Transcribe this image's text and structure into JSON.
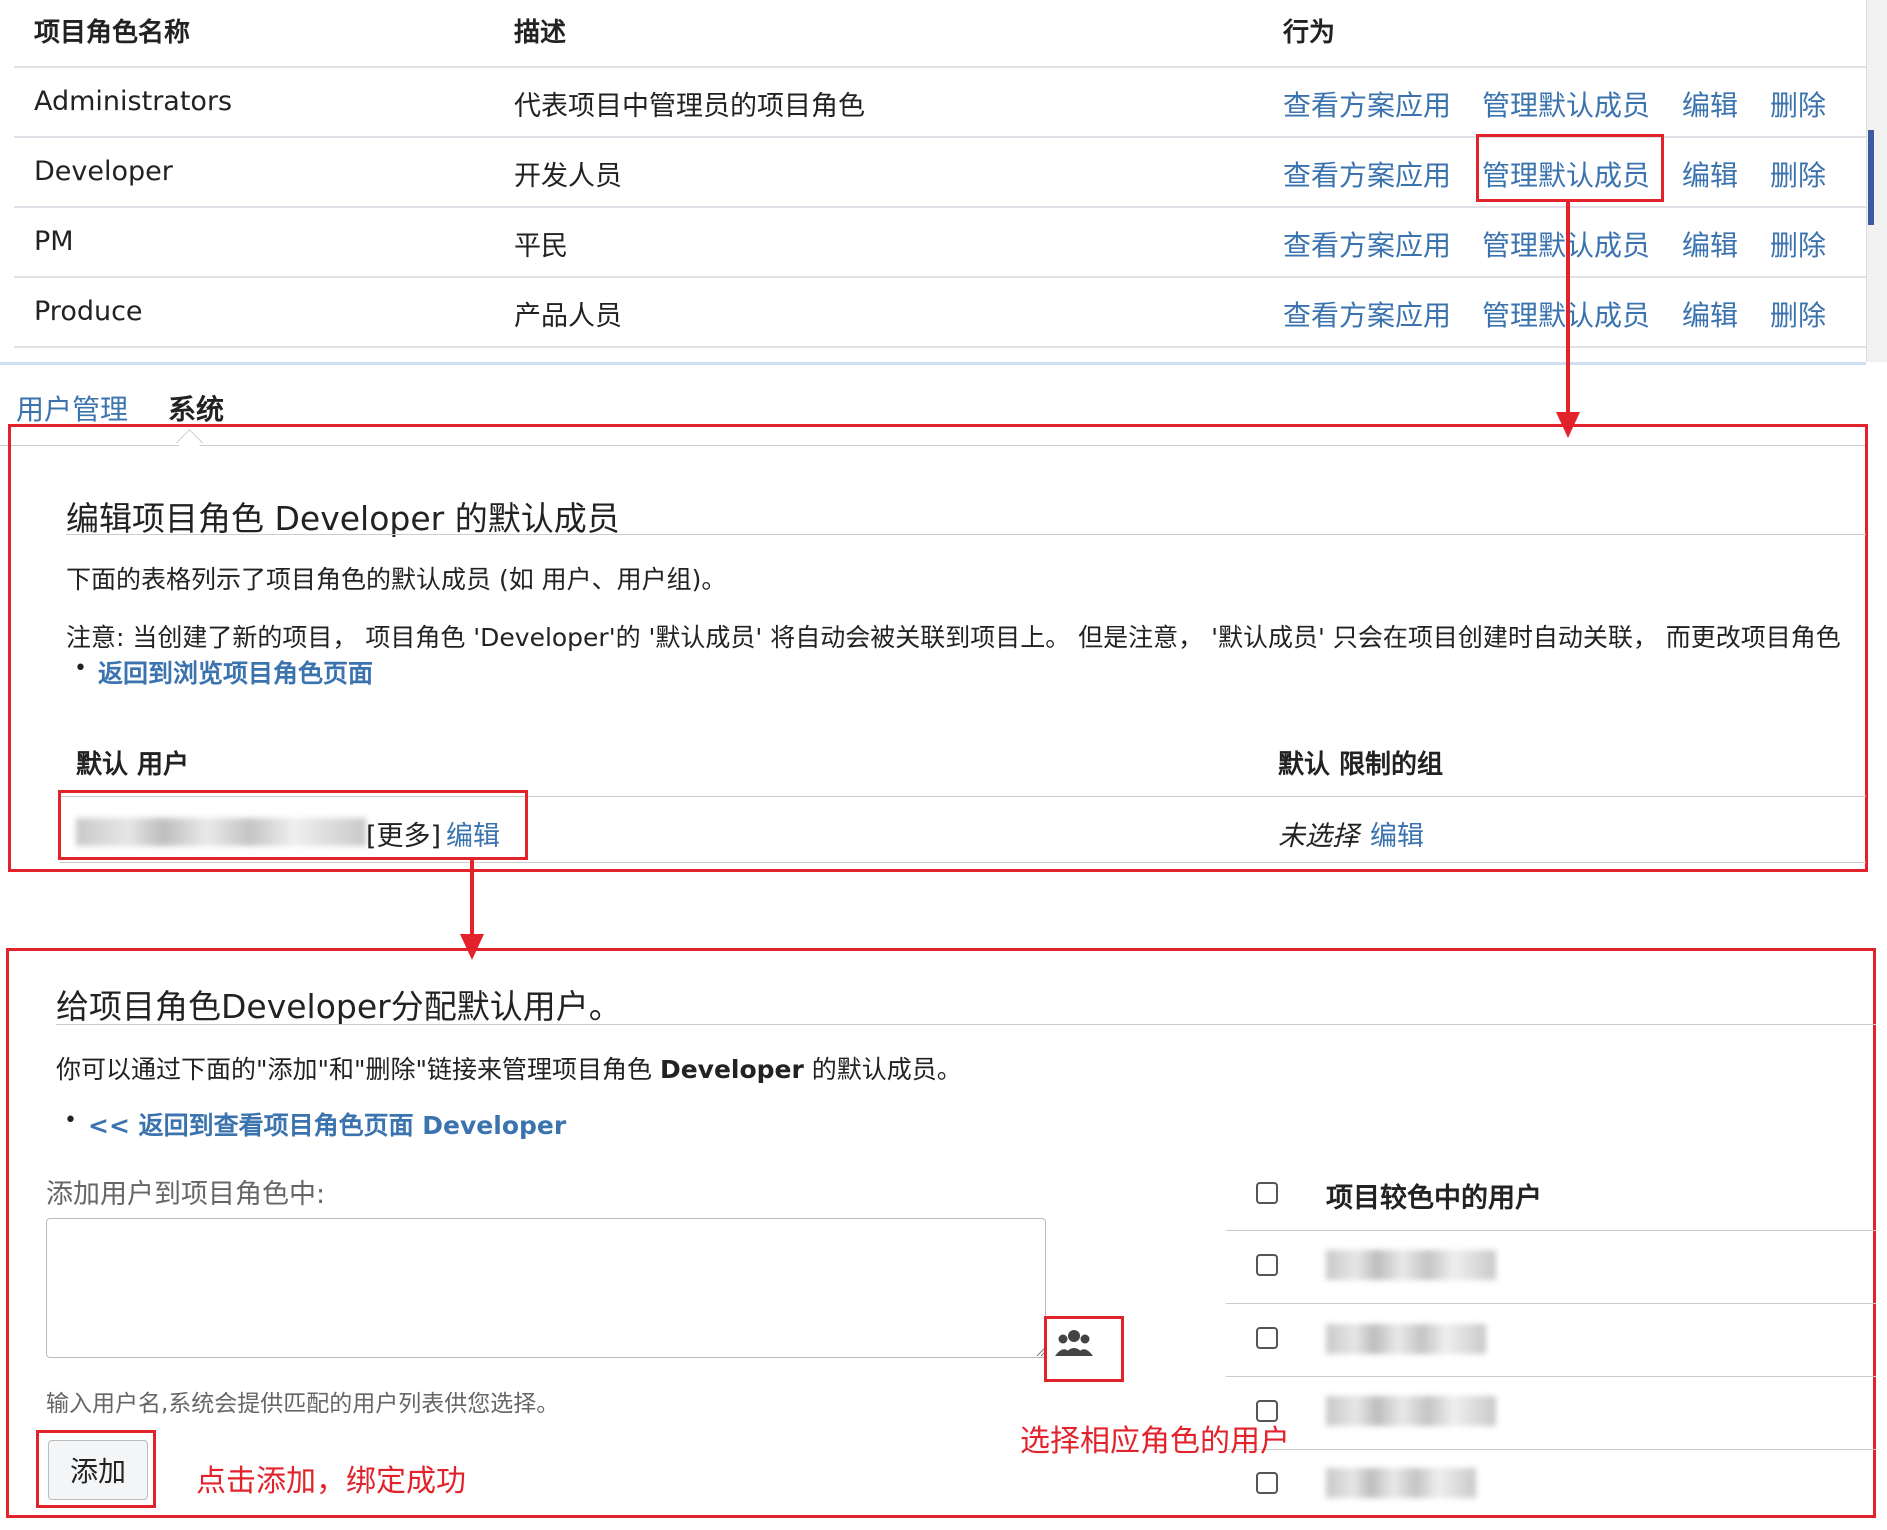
{
  "roles_table": {
    "headers": {
      "name": "项目角色名称",
      "description": "描述",
      "actions": "行为"
    },
    "rows": [
      {
        "name": "Administrators",
        "description": "代表项目中管理员的项目角色"
      },
      {
        "name": "Developer",
        "description": "开发人员"
      },
      {
        "name": "PM",
        "description": "平民"
      },
      {
        "name": "Produce",
        "description": "产品人员"
      }
    ],
    "actions": {
      "view_scheme": "查看方案应用",
      "manage_defaults": "管理默认成员",
      "edit": "编辑",
      "delete": "删除"
    }
  },
  "tabs": {
    "user_management": "用户管理",
    "system": "系统"
  },
  "default_members": {
    "title": "编辑项目角色 Developer 的默认成员",
    "desc": "下面的表格列示了项目角色的默认成员 (如 用户、用户组)。",
    "note": "注意: 当创建了新的项目， 项目角色 'Developer'的 '默认成员' 将自动会被关联到项目上。 但是注意， '默认成员' 只会在项目创建时自动关联， 而更改项目角色",
    "back_link": "返回到浏览项目角色页面",
    "col_users": "默认 用户",
    "col_groups": "默认 限制的组",
    "users_more": "[更多]",
    "users_edit": "编辑",
    "groups_none": "未选择",
    "groups_edit": "编辑"
  },
  "assign": {
    "title": "给项目角色Developer分配默认用户。",
    "desc_prefix": "你可以通过下面的\"添加\"和\"删除\"链接来管理项目角色 ",
    "desc_role": "Developer",
    "desc_suffix": " 的默认成员。",
    "back_link": "<< 返回到查看项目角色页面 Developer",
    "add_label": "添加用户到项目角色中:",
    "hint": "输入用户名,系统会提供匹配的用户列表供您选择。",
    "add_button": "添加",
    "users_header": "项目较色中的用户"
  },
  "annotations": {
    "select_user": "选择相应角色的用户",
    "click_add": "点击添加，绑定成功"
  },
  "icons": {
    "user_picker": "users-icon"
  },
  "colors": {
    "link": "#3b73af",
    "annotation_red": "#e3232c"
  }
}
